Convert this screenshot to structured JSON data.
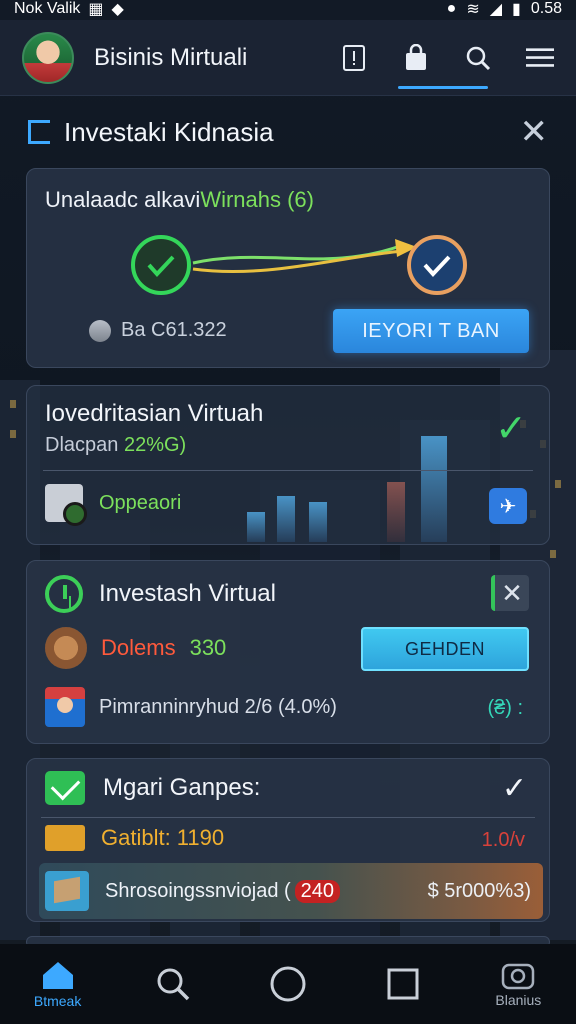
{
  "status_bar": {
    "carrier": "Nok Valik",
    "time": "0.58"
  },
  "app_bar": {
    "title": "Bisinis Mirtuali"
  },
  "section": {
    "title": "Investaki Kidnasia"
  },
  "card1": {
    "title_prefix": "Unalaadc alkavi",
    "title_highlight": "Wirnahs (6)",
    "balance": "Ba C61.322",
    "button": "IEYORI T BAN"
  },
  "card2": {
    "title": "Iovedritasian Virtuah",
    "subtitle_prefix": "Dlacpan",
    "subtitle_highlight": "22%G)",
    "row_label": "Oppeaori"
  },
  "card3": {
    "title": "Investash Virtual",
    "row1_label": "Dolems",
    "row1_value": "330",
    "button": "GEHDEN",
    "row2_label": "Pimranninryhud 2/6 (4.0%)",
    "row2_right": "(₴) :"
  },
  "card4": {
    "title": "Mgari Ganpes:",
    "row1_label": "Gatiblt: 1190",
    "row1_right": "1.0/v",
    "row2_label": "Shrosoingssnviojad (",
    "row2_badge": "240",
    "row2_amount": "$ 5r000%3)"
  },
  "bottom_nav": [
    {
      "label": "Btmeak",
      "icon": "home-icon"
    },
    {
      "label": "",
      "icon": "search-icon"
    },
    {
      "label": "",
      "icon": "circle-icon"
    },
    {
      "label": "",
      "icon": "square-icon"
    },
    {
      "label": "Blanius",
      "icon": "camera-icon"
    }
  ],
  "colors": {
    "accent_blue": "#3da9ff",
    "accent_green": "#7ce05c",
    "alert_red": "#ff5a3c",
    "amber": "#f0b030"
  }
}
